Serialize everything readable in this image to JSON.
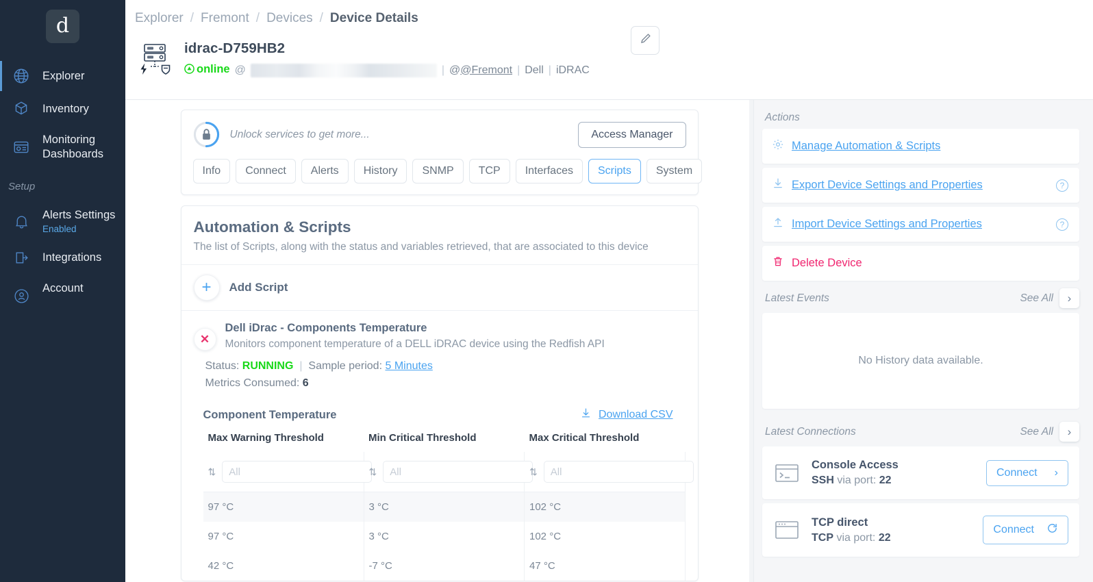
{
  "sidebar": {
    "logo_glyph": "d",
    "items": [
      {
        "label": "Explorer",
        "icon": "globe-network-icon",
        "active": true
      },
      {
        "label": "Inventory",
        "icon": "cube-icon",
        "active": false
      },
      {
        "label": "Monitoring Dashboards",
        "icon": "dashboard-icon",
        "active": false
      }
    ],
    "setup_label": "Setup",
    "setup_items": [
      {
        "label": "Alerts Settings",
        "sub": "Enabled",
        "icon": "bell-icon"
      },
      {
        "label": "Integrations",
        "sub": "",
        "icon": "integrations-icon"
      },
      {
        "label": "Account",
        "sub": "",
        "icon": "user-icon"
      }
    ]
  },
  "breadcrumb": {
    "items": [
      "Explorer",
      "Fremont",
      "Devices"
    ],
    "current": "Device Details",
    "separator": "/"
  },
  "device": {
    "name": "idrac-D759HB2",
    "status": "online",
    "at": "@",
    "host_redacted": "",
    "site": "@Fremont",
    "vendor": "Dell",
    "product": "iDRAC",
    "edit_icon": "pencil-icon"
  },
  "unlock": {
    "icon": "lock-icon",
    "text": "Unlock services to get more...",
    "button": "Access Manager"
  },
  "tabs": [
    {
      "label": "Info",
      "active": false
    },
    {
      "label": "Connect",
      "active": false
    },
    {
      "label": "Alerts",
      "active": false
    },
    {
      "label": "History",
      "active": false
    },
    {
      "label": "SNMP",
      "active": false
    },
    {
      "label": "TCP",
      "active": false
    },
    {
      "label": "Interfaces",
      "active": false
    },
    {
      "label": "Scripts",
      "active": true
    },
    {
      "label": "System",
      "active": false
    }
  ],
  "scripts_section": {
    "title": "Automation & Scripts",
    "description": "The list of Scripts, along with the status and variables retrieved, that are associated to this device",
    "add_label": "Add Script",
    "add_icon": "plus-icon",
    "script": {
      "remove_icon": "close-x-icon",
      "name": "Dell iDrac - Components Temperature",
      "description": "Monitors component temperature of a DELL iDRAC device using the Redfish API",
      "status_label": "Status:",
      "status_value": "RUNNING",
      "sample_label": "Sample period:",
      "sample_value": "5 Minutes",
      "metrics_label": "Metrics Consumed:",
      "metrics_value": "6"
    }
  },
  "table": {
    "title": "Component Temperature",
    "download_label": "Download CSV",
    "download_icon": "download-icon",
    "sort_icon": "sort-updown-icon",
    "filter_placeholder": "All",
    "columns": [
      "Max Warning Threshold",
      "Min Critical Threshold",
      "Max Critical Threshold"
    ],
    "rows": [
      [
        "97 °C",
        "3 °C",
        "102 °C"
      ],
      [
        "97 °C",
        "3 °C",
        "102 °C"
      ],
      [
        "42 °C",
        "-7 °C",
        "47 °C"
      ]
    ]
  },
  "actions": {
    "label": "Actions",
    "items": [
      {
        "label": "Manage Automation & Scripts",
        "icon": "gear-icon",
        "help": false,
        "danger": false
      },
      {
        "label": "Export Device Settings and Properties",
        "icon": "download-icon",
        "help": true,
        "danger": false
      },
      {
        "label": "Import Device Settings and Properties",
        "icon": "upload-icon",
        "help": true,
        "danger": false
      },
      {
        "label": "Delete Device",
        "icon": "trash-icon",
        "help": false,
        "danger": true
      }
    ],
    "help_glyph": "?"
  },
  "latest_events": {
    "label": "Latest Events",
    "see_all": "See All",
    "see_all_icon": "chevron-right-icon",
    "empty_text": "No History data available."
  },
  "latest_connections": {
    "label": "Latest Connections",
    "see_all": "See All",
    "see_all_icon": "chevron-right-icon",
    "items": [
      {
        "title": "Console Access",
        "proto": "SSH",
        "via": "via port:",
        "port": "22",
        "icon": "terminal-icon",
        "button": "Connect",
        "button_icon": "chevron-right-icon"
      },
      {
        "title": "TCP direct",
        "proto": "TCP",
        "via": "via port:",
        "port": "22",
        "icon": "window-icon",
        "button": "Connect",
        "button_icon": "refresh-icon"
      }
    ]
  },
  "colors": {
    "sidebar_bg": "#1e2b3c",
    "accent_blue": "#4aa3f0",
    "status_green": "#18d818",
    "danger_pink": "#f0256f",
    "text_slate": "#5a6b80"
  }
}
